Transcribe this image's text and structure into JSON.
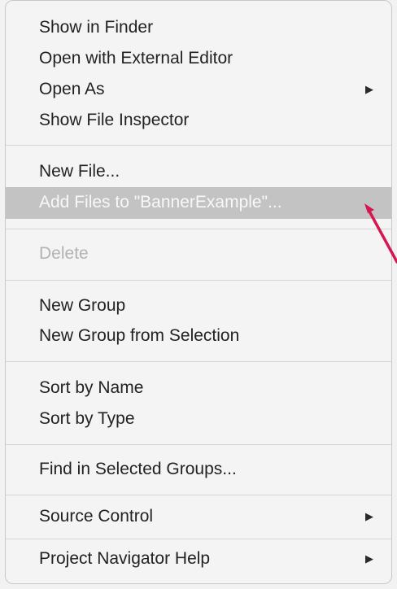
{
  "menu": {
    "items": [
      {
        "label": "Show in Finder"
      },
      {
        "label": "Open with External Editor"
      },
      {
        "label": "Open As",
        "submenu": true
      },
      {
        "label": "Show File Inspector"
      },
      {
        "label": "New File..."
      },
      {
        "label": "Add Files to \"BannerExample\"...",
        "highlighted": true
      },
      {
        "label": "Delete",
        "disabled": true
      },
      {
        "label": "New Group"
      },
      {
        "label": "New Group from Selection"
      },
      {
        "label": "Sort by Name"
      },
      {
        "label": "Sort by Type"
      },
      {
        "label": "Find in Selected Groups..."
      },
      {
        "label": "Source Control",
        "submenu": true
      },
      {
        "label": "Project Navigator Help",
        "submenu": true
      }
    ]
  },
  "colors": {
    "highlight": "#c3c3c3",
    "annotation_arrow": "#d6174f"
  },
  "icons": {
    "submenu": "submenu-arrow-icon"
  }
}
